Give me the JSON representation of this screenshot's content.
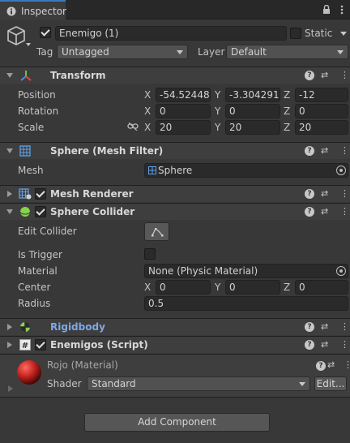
{
  "tab": {
    "label": "Inspector"
  },
  "object": {
    "name": "Enemigo (1)",
    "static_label": "Static",
    "tag_label": "Tag",
    "tag_value": "Untagged",
    "layer_label": "Layer",
    "layer_value": "Default"
  },
  "transform": {
    "title": "Transform",
    "position_label": "Position",
    "rotation_label": "Rotation",
    "scale_label": "Scale",
    "axis_x": "X",
    "axis_y": "Y",
    "axis_z": "Z",
    "position": {
      "x": "-54.52448",
      "y": "-3.304291",
      "z": "-12"
    },
    "rotation": {
      "x": "0",
      "y": "0",
      "z": "0"
    },
    "scale": {
      "x": "20",
      "y": "20",
      "z": "20"
    }
  },
  "mesh_filter": {
    "title": "Sphere (Mesh Filter)",
    "mesh_label": "Mesh",
    "mesh_value": "Sphere"
  },
  "mesh_renderer": {
    "title": "Mesh Renderer"
  },
  "sphere_collider": {
    "title": "Sphere Collider",
    "edit_label": "Edit Collider",
    "trigger_label": "Is Trigger",
    "material_label": "Material",
    "material_value": "None (Physic Material)",
    "center_label": "Center",
    "center": {
      "x": "0",
      "y": "0",
      "z": "0"
    },
    "radius_label": "Radius",
    "radius_value": "0.5"
  },
  "rigidbody": {
    "title": "Rigidbody"
  },
  "script": {
    "title": "Enemigos (Script)"
  },
  "material": {
    "title": "Rojo (Material)",
    "shader_label": "Shader",
    "shader_value": "Standard",
    "edit_label": "Edit..."
  },
  "add_component": {
    "label": "Add Component"
  },
  "colors": {
    "background": "#383838",
    "header": "#3e3e3e",
    "field": "#2a2a2a",
    "accent": "#3a79bb",
    "rigidbody_title": "#7fa8e6",
    "material_red": "#c0231e"
  },
  "icons": {
    "lock": "lock-icon",
    "menu": "kebab-menu-icon",
    "help": "help-icon",
    "presets": "presets-icon",
    "context": "context-menu-icon"
  }
}
